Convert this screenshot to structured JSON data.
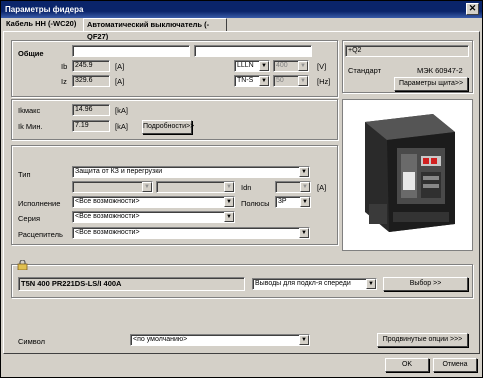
{
  "window": {
    "title": "Параметры фидера",
    "close_glyph": "✕"
  },
  "tabs": [
    {
      "label": "Кабель НН (-WC20)"
    },
    {
      "label": "Автоматический выключатель (-QF27)"
    }
  ],
  "general": {
    "heading": "Общие",
    "name1": "",
    "name2": "",
    "ib_label": "Ib",
    "ib_value": "245.9",
    "ib_unit": "[A]",
    "iz_label": "Iz",
    "iz_value": "329.6",
    "iz_unit": "[A]",
    "system_value": "LLLN",
    "voltage_value": "400",
    "voltage_unit": "[V]",
    "earthing_value": "TN-S",
    "freq_value": "50",
    "freq_unit": "[Hz]"
  },
  "panel_info": {
    "id_value": "+Q2",
    "standard_label": "Стандарт",
    "standard_value": "МЭК 60947-2",
    "board_params_button": "Параметры щита>>"
  },
  "shortcircuit": {
    "ikmax_label": "Ikмакс",
    "ikmax_value": "14.96",
    "ikmax_unit": "[kA]",
    "ikmin_label": "Ik Мин.",
    "ikmin_value": "7.19",
    "ikmin_unit": "[kA]",
    "details_button": "Подробности>>"
  },
  "selection": {
    "type_label": "Тип",
    "type_value": "Защита от КЗ и перегрузки",
    "idn_label": "Idn",
    "idn_unit": "[A]",
    "version_label": "Исполнение",
    "version_value": "<Все возможности>",
    "poles_label": "Полюсы",
    "poles_value": "3P",
    "series_label": "Серия",
    "series_value": "<Все возможности>",
    "release_label": "Расцепитель",
    "release_value": "<Все возможности>"
  },
  "result": {
    "device_name": "T5N 400 PR221DS-LS/I 400A",
    "terminals_value": "Выводы для подкл-я спереди",
    "select_button": "Выбор >>"
  },
  "symbol": {
    "label": "Символ",
    "value": "<по умолчанию>",
    "advanced_button": "Продвинутые опции >>>"
  },
  "footer": {
    "ok": "OK",
    "cancel": "Отмена"
  },
  "icons": {
    "dropdown": "▼",
    "lock": "lock-icon"
  }
}
